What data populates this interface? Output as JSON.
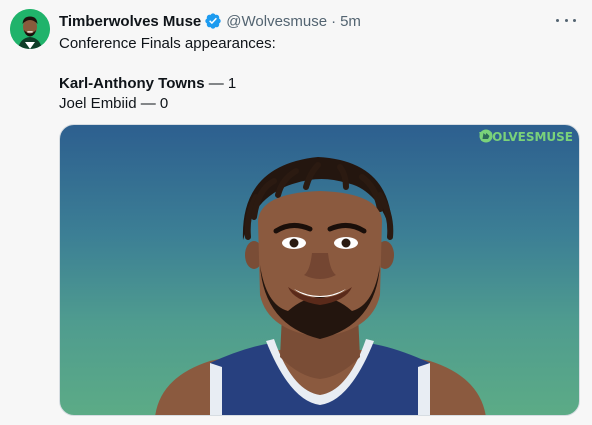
{
  "tweet": {
    "author": {
      "display_name": "Timberwolves Muse",
      "handle": "@Wolvesmuse",
      "separator": "·",
      "time": "5m",
      "verified_color": "#1d9bf0",
      "avatar_bg": "#20b36b"
    },
    "text": {
      "intro": "Conference Finals appearances:",
      "rows": [
        {
          "name": "Karl-Anthony Towns",
          "sep": " — ",
          "value": "1",
          "bold": true
        },
        {
          "name": "Joel Embiid",
          "sep": " — ",
          "value": "0",
          "bold": false
        }
      ]
    },
    "media": {
      "watermark": "WOLVESMUSE",
      "gradient_top": "#2d5f8f",
      "gradient_bottom": "#5cab86"
    },
    "icons": {
      "more": "more-options-icon",
      "verified": "verified-badge-icon",
      "watermark": "wolf-logo-icon"
    }
  }
}
